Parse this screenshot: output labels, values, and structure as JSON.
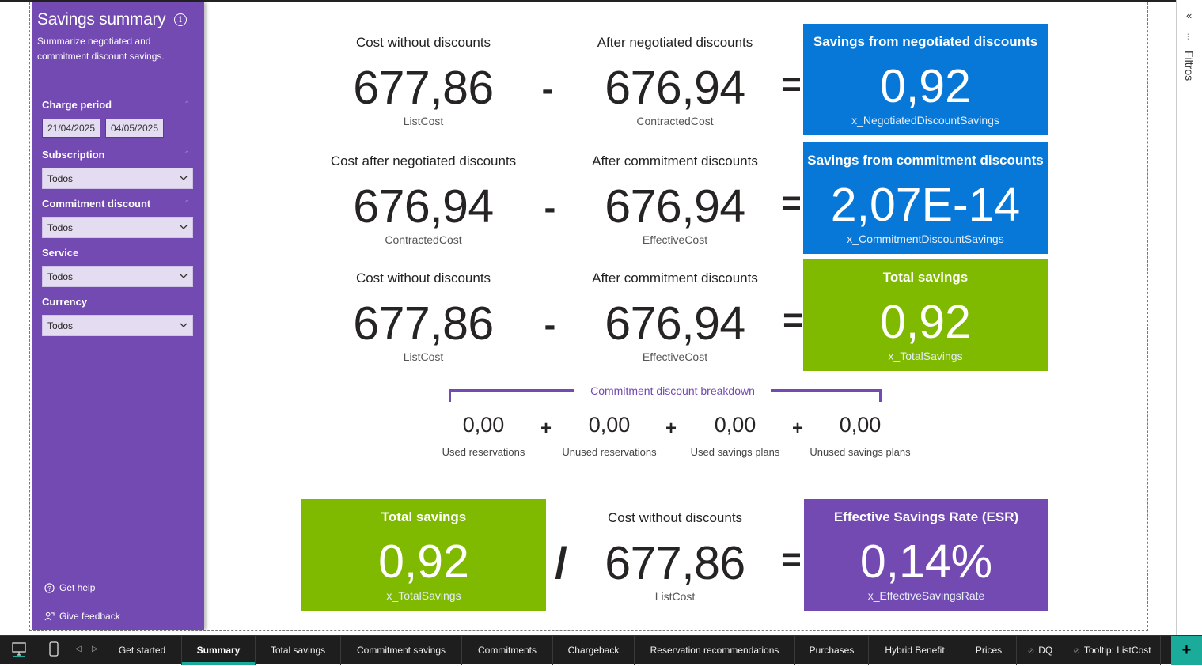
{
  "sidebar": {
    "title": "Savings summary",
    "subtitle": "Summarize negotiated and commitment discount savings.",
    "filters": [
      {
        "label": "Charge period"
      },
      {
        "label": "Subscription",
        "value": "Todos"
      },
      {
        "label": "Commitment discount",
        "value": "Todos"
      },
      {
        "label": "Service",
        "value": "Todos"
      },
      {
        "label": "Currency",
        "value": "Todos"
      }
    ],
    "date_start": "21/04/2025",
    "date_end": "04/05/2025",
    "get_help": "Get help",
    "give_feedback": "Give feedback"
  },
  "rows": [
    {
      "left_label": "Cost without discounts",
      "left_value": "677,86",
      "left_sub": "ListCost",
      "op": "-",
      "mid_label": "After negotiated discounts",
      "mid_value": "676,94",
      "mid_sub": "ContractedCost",
      "card_title": "Savings from negotiated discounts",
      "card_value": "0,92",
      "card_sub": "x_NegotiatedDiscountSavings",
      "card_color": "#0878d8"
    },
    {
      "left_label": "Cost after negotiated discounts",
      "left_value": "676,94",
      "left_sub": "ContractedCost",
      "op": "-",
      "mid_label": "After commitment discounts",
      "mid_value": "676,94",
      "mid_sub": "EffectiveCost",
      "card_title": "Savings from commitment discounts",
      "card_value": "2,07E-14",
      "card_sub": "x_CommitmentDiscountSavings",
      "card_color": "#0878d8"
    },
    {
      "left_label": "Cost without discounts",
      "left_value": "677,86",
      "left_sub": "ListCost",
      "op": "-",
      "mid_label": "After commitment discounts",
      "mid_value": "676,94",
      "mid_sub": "EffectiveCost",
      "card_title": "Total savings",
      "card_value": "0,92",
      "card_sub": "x_TotalSavings",
      "card_color": "#7fba00"
    }
  ],
  "equals": "=",
  "breakdown": {
    "title": "Commitment discount breakdown",
    "plus": "+",
    "items": [
      {
        "value": "0,00",
        "label": "Used reservations"
      },
      {
        "value": "0,00",
        "label": "Unused reservations"
      },
      {
        "value": "0,00",
        "label": "Used savings plans"
      },
      {
        "value": "0,00",
        "label": "Unused savings plans"
      }
    ]
  },
  "esr_row": {
    "left_title": "Total savings",
    "left_value": "0,92",
    "left_sub": "x_TotalSavings",
    "op": "/",
    "mid_label": "Cost without discounts",
    "mid_value": "677,86",
    "mid_sub": "ListCost",
    "right_title": "Effective Savings Rate (ESR)",
    "right_value": "0,14%",
    "right_sub": "x_EffectiveSavingsRate"
  },
  "filter_pane": {
    "label": "Filtros",
    "collapse": "«"
  },
  "tabs": [
    {
      "label": "Get started"
    },
    {
      "label": "Summary",
      "active": true
    },
    {
      "label": "Total savings"
    },
    {
      "label": "Commitment savings"
    },
    {
      "label": "Commitments"
    },
    {
      "label": "Chargeback"
    },
    {
      "label": "Reservation recommendations"
    },
    {
      "label": "Purchases"
    },
    {
      "label": "Hybrid Benefit"
    },
    {
      "label": "Prices"
    },
    {
      "label": "DQ",
      "hidden": true
    },
    {
      "label": "Tooltip: ListCost",
      "hidden": true
    }
  ],
  "add_tab": "+"
}
